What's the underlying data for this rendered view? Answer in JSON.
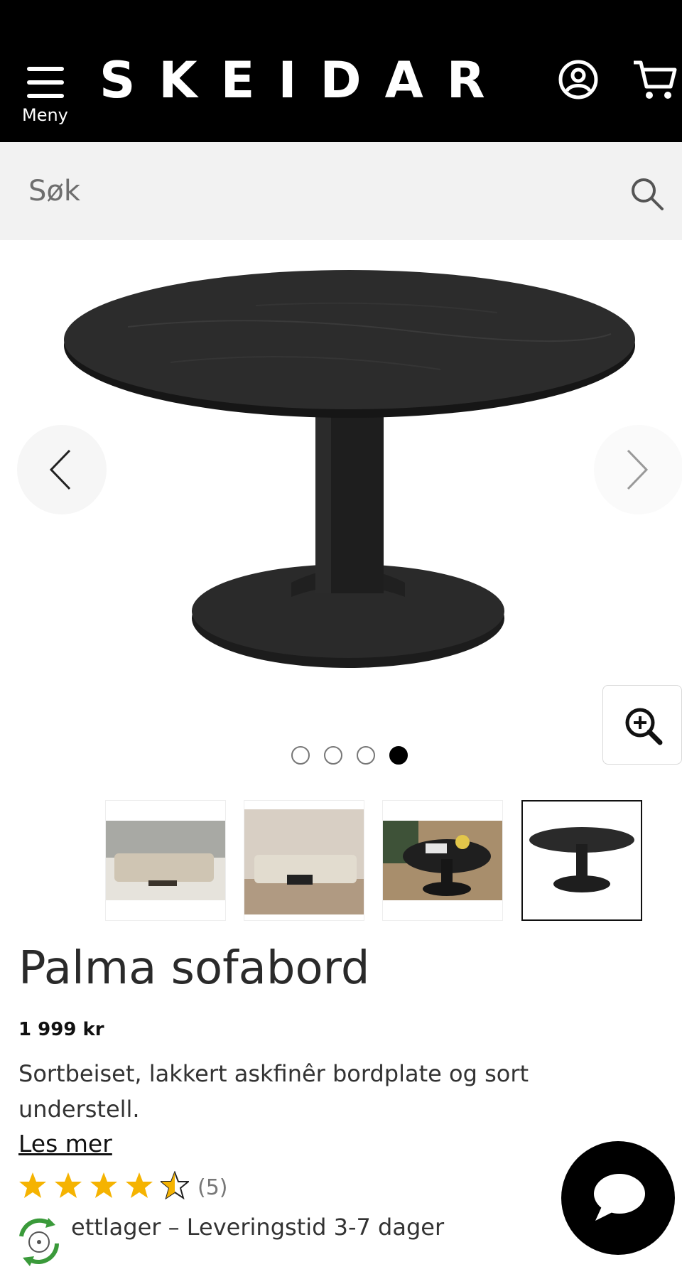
{
  "header": {
    "menu_label": "Meny",
    "logo_text": "SKEIDAR",
    "background_color": "#000000"
  },
  "search": {
    "placeholder": "Søk"
  },
  "gallery": {
    "slide_count": 4,
    "active_slide": 4,
    "thumbnails": [
      "living-room-sofa",
      "living-room-wide",
      "table-in-room",
      "table-product"
    ]
  },
  "product": {
    "title": "Palma sofabord",
    "price": "1 999 kr",
    "description": "Sortbeiset, lakkert askfinêr bordplate og sort understell.",
    "read_more": "Les mer",
    "rating": 4.5,
    "review_count": "(5)",
    "stock_text": "ettlager – Leveringstid 3-7 dager"
  },
  "colors": {
    "star": "#f5b301",
    "stock_icon": "#3a9a3a"
  }
}
